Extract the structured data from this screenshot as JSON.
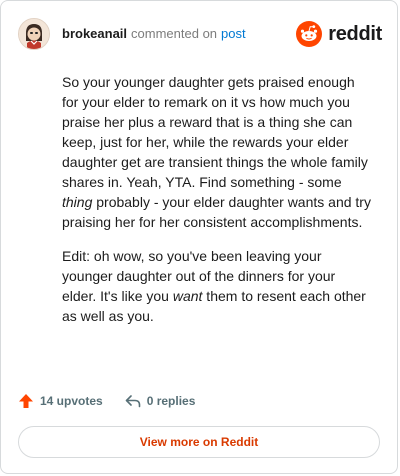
{
  "comment": {
    "username": "brokeanail",
    "verb": "commented on",
    "post_link": "post",
    "paragraph_1": {
      "part_1": "So your younger daughter gets praised enough for your elder to remark on it vs how much you praise her plus a reward that is a thing she can keep, just for her, while the rewards your elder daughter get are transient things the whole family shares in. Yeah, YTA. Find something - some ",
      "emphasis": "thing",
      "part_2": " probably - your elder daughter wants and try praising her for her consistent accomplishments."
    },
    "paragraph_2": {
      "part_1": "Edit: oh wow, so you've been leaving your younger daughter out of the dinners for your elder. It's like you ",
      "emphasis": "want",
      "part_2": " them to resent each other as well as you."
    }
  },
  "brand": {
    "wordmark": "reddit",
    "icon": "reddit-snoo-icon",
    "color": "#ff4500"
  },
  "actions": {
    "upvotes_label": "14 upvotes",
    "upvote_icon": "upvote-arrow-icon",
    "upvote_color": "#ff4500",
    "replies_label": "0 replies",
    "reply_icon": "reply-arrow-icon"
  },
  "footer": {
    "view_more_label": "View more on Reddit",
    "link_color": "#d93a00"
  }
}
